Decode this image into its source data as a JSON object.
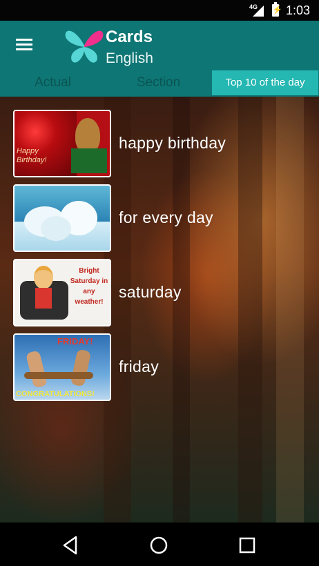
{
  "status_bar": {
    "network": "4G",
    "time": "1:03"
  },
  "app_bar": {
    "title": "Cards",
    "subtitle": "English",
    "menu_icon": "hamburger-menu-icon",
    "logo_icon": "butterfly-logo-icon"
  },
  "tabs": [
    {
      "label": "Actual",
      "active": false
    },
    {
      "label": "Section",
      "active": false
    },
    {
      "label": "Top 10 of the day",
      "active": true
    }
  ],
  "list": [
    {
      "label": "happy birthday",
      "thumb_caption": "Happy Birthday!"
    },
    {
      "label": "for every day"
    },
    {
      "label": "saturday",
      "thumb_caption": "Bright Saturday in any weather!"
    },
    {
      "label": "friday",
      "thumb_caption_top": "FRIDAY!",
      "thumb_caption_bottom": "CONGRATULATIONS!"
    }
  ],
  "nav_bar": {
    "back_icon": "back-icon",
    "home_icon": "home-icon",
    "recents_icon": "recents-icon"
  },
  "colors": {
    "app_bar": "#0e7674",
    "active_tab": "#25b7b2",
    "inactive_tab_text": "#0a5553"
  }
}
